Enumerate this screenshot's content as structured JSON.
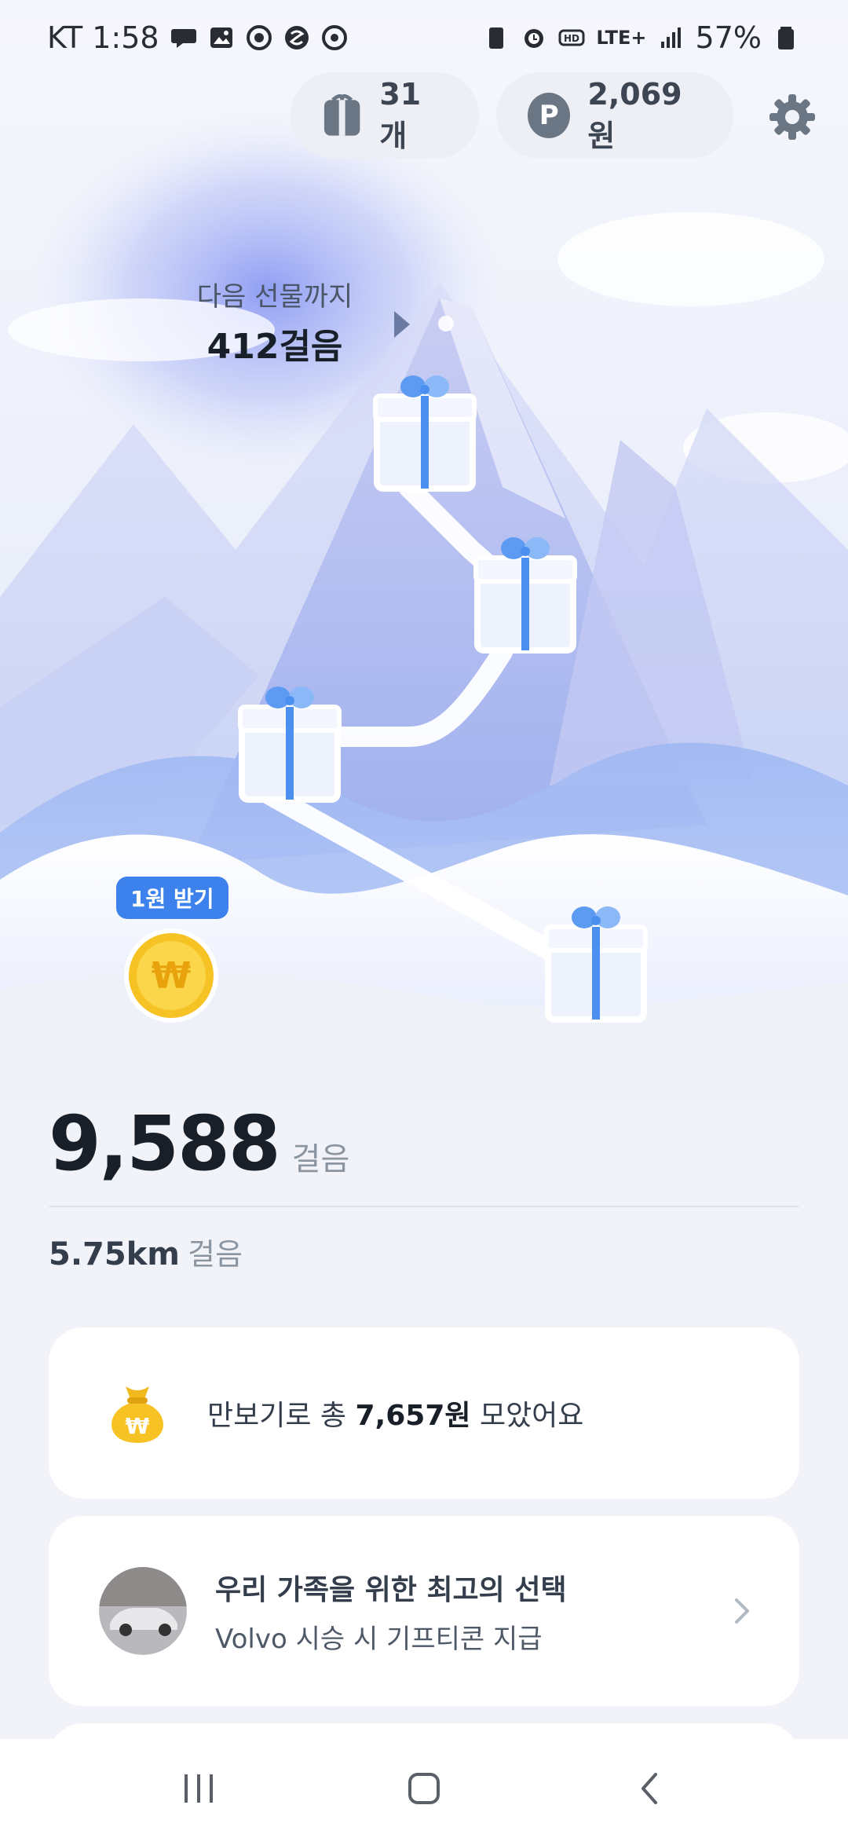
{
  "status_bar": {
    "carrier_time": "KT 1:58",
    "network": "LTE+",
    "battery": "57%"
  },
  "top_bar": {
    "gift_count": "31개",
    "points": "2,069원"
  },
  "next_gift": {
    "label": "다음 선물까지",
    "steps": "412걸음"
  },
  "coin": {
    "badge": "1원 받기",
    "symbol": "₩"
  },
  "stats": {
    "steps": "9,588",
    "steps_unit": "걸음",
    "distance": "5.75km",
    "distance_unit": "걸음"
  },
  "total_card": {
    "prefix": "만보기로 총 ",
    "amount": "7,657원",
    "suffix": " 모았어요"
  },
  "ad_card": {
    "title": "우리 가족을 위한 최고의 선택",
    "subtitle": "Volvo 시승 시 기프티콘 지급"
  },
  "colors": {
    "accent_blue": "#3d82ec",
    "ribbon_blue": "#4b8ff0",
    "coin_gold": "#f7c324",
    "text_dark": "#191f28",
    "text_gray": "#8b95a1"
  }
}
